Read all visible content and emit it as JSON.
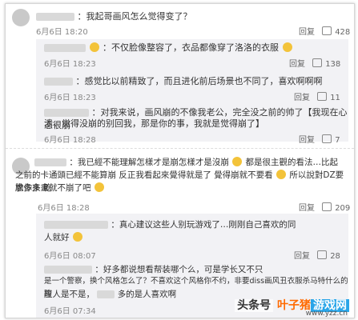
{
  "colors": {
    "name_accent": "#eb7350",
    "reply_bg": "#f2f2f5",
    "watermark_orange": "#ff6a00",
    "watermark_blue": "#2aa5e8"
  },
  "c1": {
    "text": "：我起哥画风怎么觉得变了？",
    "date": "6月6日 18:20",
    "reply": "回复",
    "likes": "428"
  },
  "c1r1": {
    "text": "：不仅脸像整容了，衣品都像穿了洛洛的衣服",
    "date": "6月6日 18:23",
    "reply": "回复",
    "likes": "138"
  },
  "c1r2": {
    "text": "：感觉比以前精致了，而且进化前后场景也不同了，喜欢啊啊啊",
    "date": "6月6日 18:23",
    "reply": "回复",
    "likes": "11"
  },
  "c1r3": {
    "line1": "：对我来说，画风崩的不像我老公，完全没之前的帅了【我现在心态很崩",
    "line2": "溃，觉得没崩的别回我，那是你的事，我就是觉得崩了】",
    "date": "6月6日 18:28",
    "reply": "回复",
    "likes": "7"
  },
  "c2": {
    "line1": "：我已經不能理解怎樣才是崩怎樣才是沒崩",
    "line1b": "都是很主觀的看法…比起",
    "line2": "之前的卡通頭已經不能算崩 反正我看起來覺得就是了 覺得崩就不要看",
    "line2b": "所以說對DZ要求多多 乾",
    "line3": "脆你來畫就不崩了吧",
    "date": "6月6日 18:28",
    "reply": "回复",
    "likes": "209"
  },
  "c2r1": {
    "line1": "：真心建议这些人别玩游戏了…刚刚自己喜欢的同",
    "line2": "人就好",
    "date": "6月6日 08:07",
    "reply": "回复",
    "likes": "28"
  },
  "c2r2": {
    "line1": "：好多都说想看帮装哪个么，可是学长又不只",
    "line2": "是一个警察，换个风格怎么了？不喜欢这个风格你不约，非要diss画风丑衣服杀马特什么的蹦",
    "line3": "应人是不是，",
    "line3b": "多的是人喜欢啊",
    "date": "6月6日 07:34"
  },
  "watermark": {
    "head": "头条号",
    "p1": "叶子猪",
    "p2": "游戏网",
    "url": "www.yzz.cn"
  }
}
